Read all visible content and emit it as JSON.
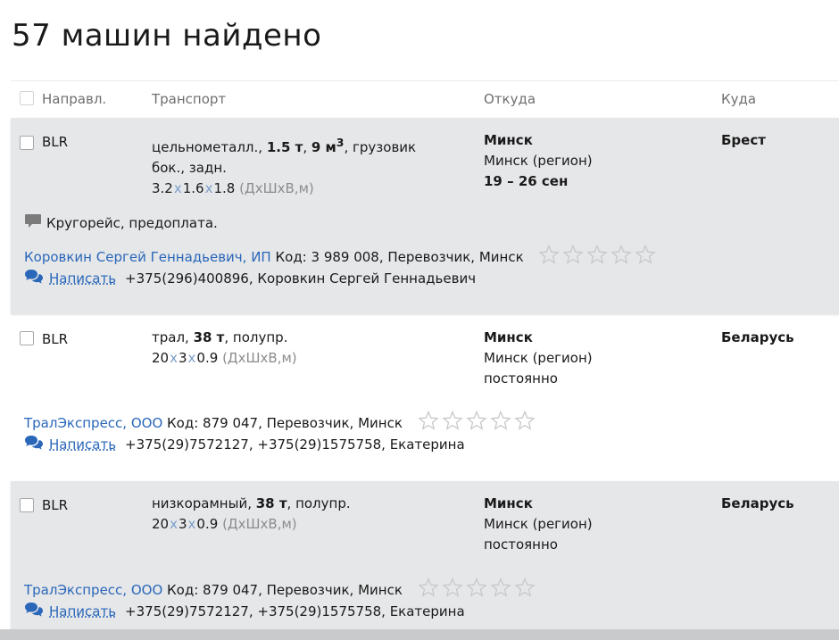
{
  "page_title": "57 машин найдено",
  "table_header": {
    "direction": "Направл.",
    "transport": "Транспорт",
    "from": "Откуда",
    "to": "Куда"
  },
  "rows": [
    {
      "direction": "BLR",
      "transport_line1_prefix": "цельнометалл., ",
      "transport_weight": "1.5 т",
      "transport_sep": ", ",
      "transport_volume": "9 м",
      "transport_volume_sup": "3",
      "transport_line1_suffix": ", грузовик",
      "transport_line2": "бок., задн.",
      "dims": [
        "3.2",
        "1.6",
        "1.8"
      ],
      "dims_sep": "x",
      "dims_note": "(ДхШхВ,м)",
      "from_city": "Минск",
      "from_region": "Минск (регион)",
      "from_date": "19  – 26 сен",
      "to": "Брест",
      "note": "Кругорейс, предоплата.",
      "company": "Коровкин Сергей Геннадьевич, ИП",
      "company_info": " Код: 3 989 008, Перевозчик, Минск",
      "write_label": "Написать",
      "phones": "+375(296)400896,  Коровкин Сергей Геннадьевич",
      "rating_stars": 0
    },
    {
      "direction": "BLR",
      "transport_line1_prefix": "трал, ",
      "transport_weight": "38 т",
      "transport_line1_suffix": ", полупр.",
      "dims": [
        "20",
        "3",
        "0.9"
      ],
      "dims_sep": "x",
      "dims_note": "(ДхШхВ,м)",
      "from_city": "Минск",
      "from_region": "Минск (регион)",
      "from_date": "постоянно",
      "to": "Беларусь",
      "company": "ТралЭкспресс, ООО",
      "company_info": " Код: 879 047, Перевозчик, Минск",
      "write_label": "Написать",
      "phones": "+375(29)7572127,  +375(29)1575758,  Екатерина",
      "rating_stars": 0
    },
    {
      "direction": "BLR",
      "transport_line1_prefix": "низкорамный, ",
      "transport_weight": "38 т",
      "transport_line1_suffix": ", полупр.",
      "dims": [
        "20",
        "3",
        "0.9"
      ],
      "dims_sep": "x",
      "dims_note": "(ДхШхВ,м)",
      "from_city": "Минск",
      "from_region": "Минск (регион)",
      "from_date": "постоянно",
      "to": "Беларусь",
      "company": "ТралЭкспресс, ООО",
      "company_info": " Код: 879 047, Перевозчик, Минск",
      "write_label": "Написать",
      "phones": "+375(29)7572127,  +375(29)1575758,  Екатерина",
      "rating_stars": 0
    }
  ],
  "colors": {
    "link": "#2a67b9",
    "row_shade": "#e6e7e9",
    "star_outline": "#c8c8c8"
  },
  "icons": {
    "chat": "chat-bubbles-icon",
    "note": "speech-bubble-icon",
    "star": "star-outline-icon"
  }
}
